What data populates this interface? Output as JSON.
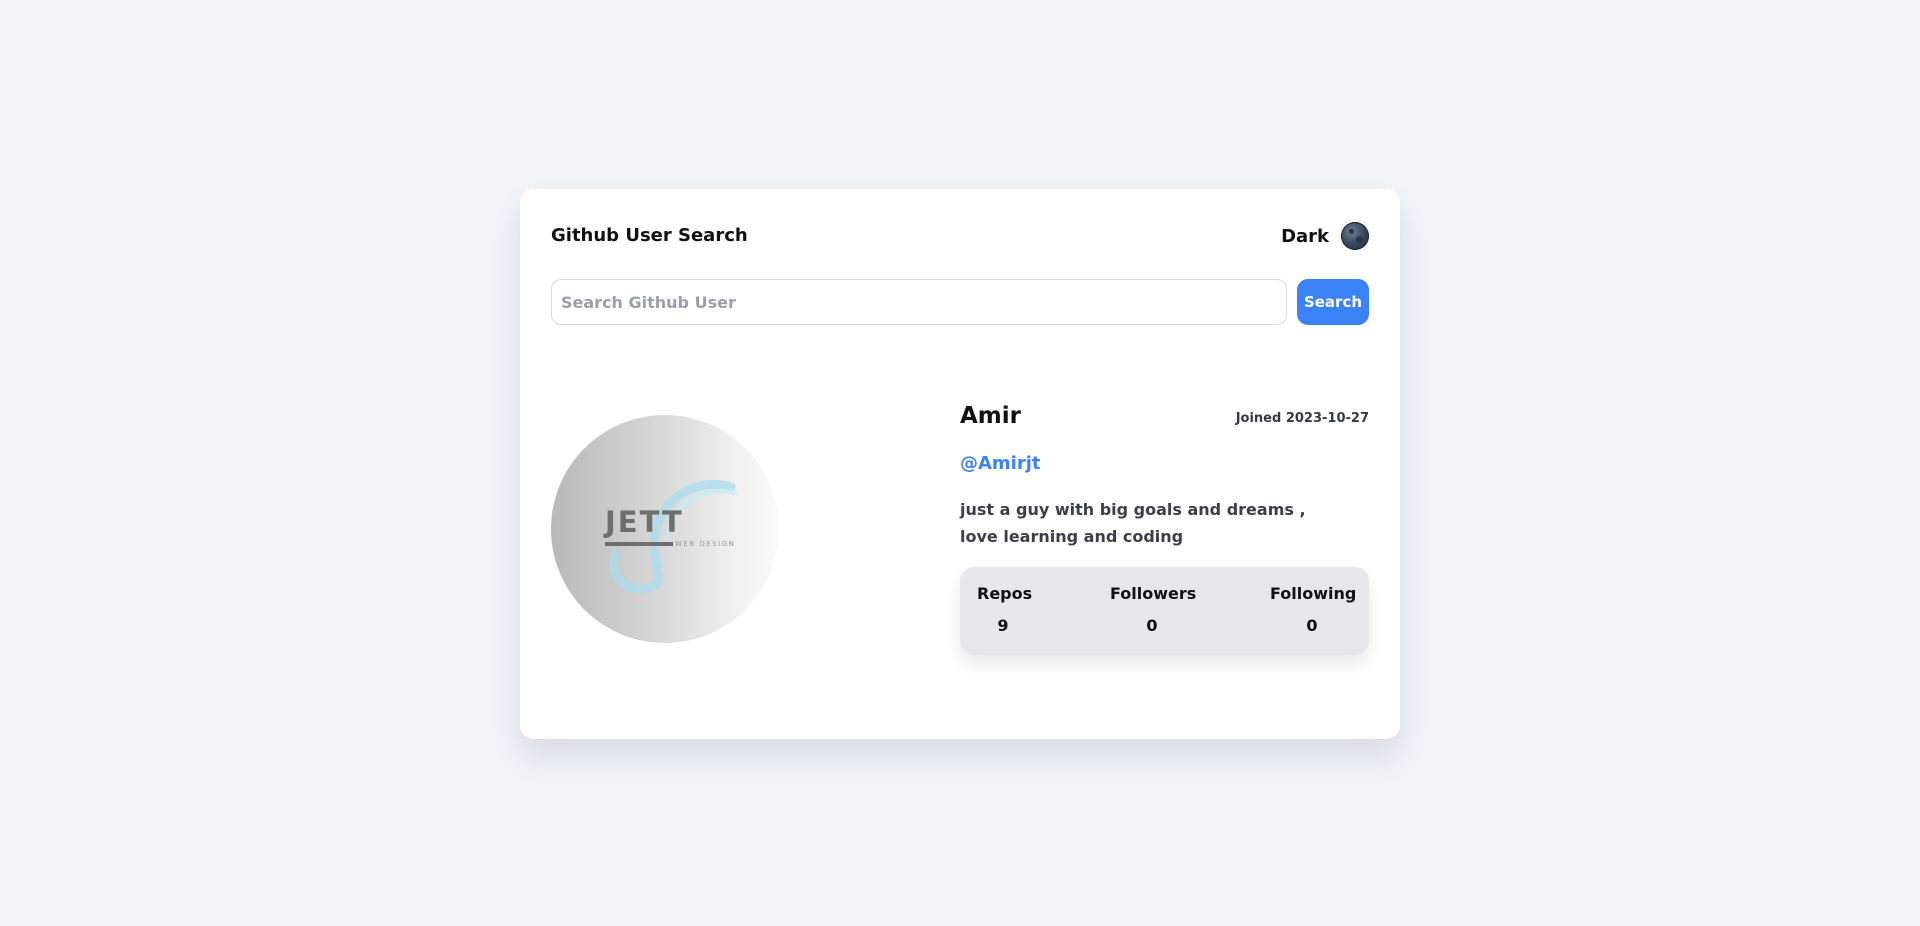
{
  "header": {
    "title": "Github User Search",
    "theme_label": "Dark",
    "theme_icon": "moon-icon"
  },
  "search": {
    "placeholder": "Search Github User",
    "value": "",
    "button_label": "Search"
  },
  "profile": {
    "avatar_logo_text": "JETT",
    "avatar_logo_subtext": "WEB DESIGN",
    "name": "Amir",
    "joined": "Joined 2023-10-27",
    "login": "@Amirjt",
    "bio": "just a guy with big goals and dreams , love learning and coding"
  },
  "stats": [
    {
      "label": "Repos",
      "value": "9"
    },
    {
      "label": "Followers",
      "value": "0"
    },
    {
      "label": "Following",
      "value": "0"
    }
  ],
  "colors": {
    "page_background": "#f0f3f8",
    "card_background": "#ffffff",
    "accent": "#3b82f6",
    "stats_background": "#e6e7ea"
  }
}
